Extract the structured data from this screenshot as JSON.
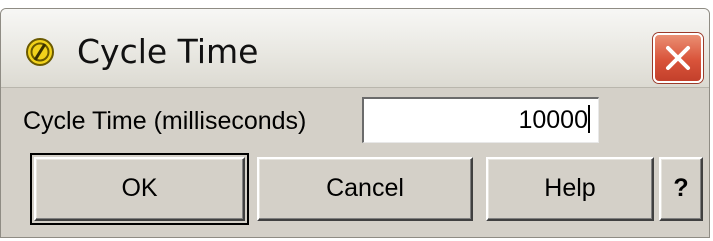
{
  "window": {
    "title": "Cycle Time",
    "title_icon": "pencil-disabled-icon",
    "close_icon": "close-icon"
  },
  "form": {
    "label": "Cycle Time (milliseconds)",
    "value": "10000"
  },
  "buttons": {
    "ok": "OK",
    "cancel": "Cancel",
    "help": "Help",
    "question": "?"
  },
  "colors": {
    "dialog_bg": "#d4d0c8",
    "close_button": "#d9533a",
    "title_icon_fill": "#f2d21b"
  }
}
